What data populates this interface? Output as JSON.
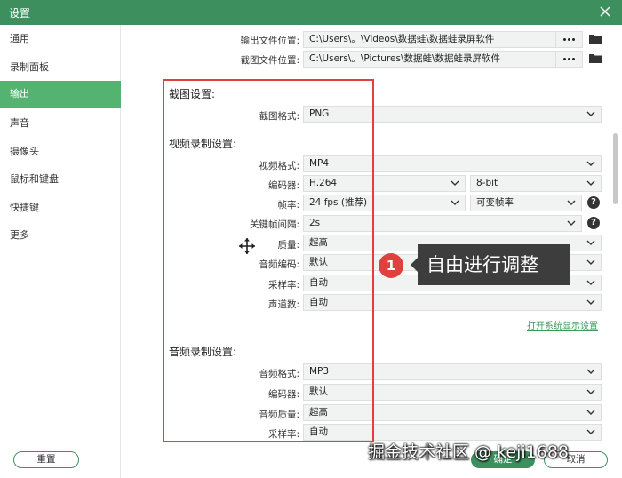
{
  "window": {
    "title": "设置"
  },
  "sidebar": {
    "items": [
      {
        "label": "通用"
      },
      {
        "label": "录制面板"
      },
      {
        "label": "输出",
        "active": true
      },
      {
        "label": "声音"
      },
      {
        "label": "摄像头"
      },
      {
        "label": "鼠标和键盘"
      },
      {
        "label": "快捷键"
      },
      {
        "label": "更多"
      }
    ]
  },
  "output": {
    "video_path_label": "输出文件位置:",
    "video_path": "C:\\Users\\。\\Videos\\数据蛙\\数据蛙录屏软件",
    "screenshot_path_label": "截图文件位置:",
    "screenshot_path": "C:\\Users\\。\\Pictures\\数据蛙\\数据蛙录屏软件"
  },
  "screenshot_settings": {
    "heading": "截图设置:",
    "format_label": "截图格式:",
    "format": "PNG"
  },
  "video_settings": {
    "heading": "视频录制设置:",
    "format_label": "视频格式:",
    "format": "MP4",
    "encoder_label": "编码器:",
    "encoder": "H.264",
    "bitdepth": "8-bit",
    "framerate_label": "帧率:",
    "framerate": "24 fps (推荐)",
    "framerate_mode": "可变帧率",
    "keyframe_label": "关键帧间隔:",
    "keyframe": "2s",
    "quality_label": "质量:",
    "quality": "超高",
    "audio_codec_label": "音频编码:",
    "audio_codec": "默认",
    "sample_rate_label": "采样率:",
    "sample_rate": "自动",
    "channels_label": "声道数:",
    "channels": "自动",
    "display_link": "打开系统显示设置"
  },
  "audio_settings": {
    "heading": "音频录制设置:",
    "format_label": "音频格式:",
    "format": "MP3",
    "encoder_label": "编码器:",
    "encoder": "默认",
    "quality_label": "音频质量:",
    "quality": "超高",
    "sample_rate_label": "采样率:",
    "sample_rate": "自动"
  },
  "help_glyph": "?",
  "callout": {
    "number": "1",
    "text": "自由进行调整"
  },
  "footer": {
    "reset": "重置",
    "ok": "确定",
    "cancel": "取消"
  },
  "watermark": "掘金技术社区 @ keji1688",
  "colors": {
    "accent": "#3e8f5e",
    "active_nav": "#55b372",
    "annotation": "#e0403e"
  },
  "icons": [
    "close-icon",
    "more-icon",
    "folder-icon",
    "chevron-down-icon",
    "help-icon",
    "move-cursor-icon"
  ]
}
